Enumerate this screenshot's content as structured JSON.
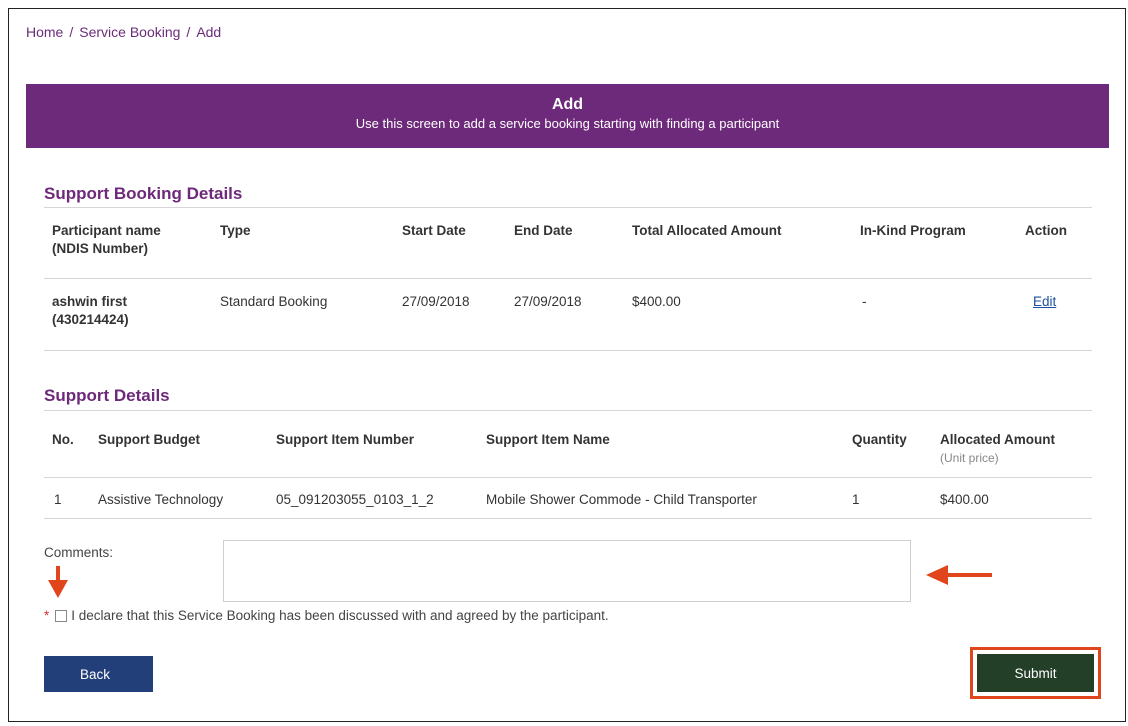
{
  "breadcrumb": {
    "home": "Home",
    "service_booking": "Service Booking",
    "current": "Add",
    "sep": "/"
  },
  "banner": {
    "title": "Add",
    "subtitle": "Use this screen to add a service booking starting with finding a participant"
  },
  "booking": {
    "title": "Support Booking Details",
    "headers": {
      "participant_line1": "Participant name",
      "participant_line2": "(NDIS Number)",
      "type": "Type",
      "start": "Start Date",
      "end": "End Date",
      "total": "Total Allocated Amount",
      "inkind": "In-Kind Program",
      "action": "Action"
    },
    "row": {
      "name": "ashwin first",
      "ndis": "(430214424)",
      "type": "Standard Booking",
      "start": "27/09/2018",
      "end": "27/09/2018",
      "total": "$400.00",
      "inkind": "-",
      "action": "Edit"
    }
  },
  "support": {
    "title": "Support Details",
    "headers": {
      "no": "No.",
      "budget": "Support Budget",
      "item_number": "Support Item Number",
      "item_name": "Support Item Name",
      "quantity": "Quantity",
      "allocated": "Allocated Amount",
      "unit_price": "(Unit price)"
    },
    "row": {
      "no": "1",
      "budget": "Assistive Technology",
      "item_number": "05_091203055_0103_1_2",
      "item_name": "Mobile Shower Commode - Child Transporter",
      "quantity": "1",
      "allocated": "$400.00"
    }
  },
  "comments": {
    "label": "Comments:",
    "value": ""
  },
  "declaration": {
    "required": "*",
    "text": "I declare that this Service Booking has been discussed with and agreed by the participant.",
    "checked": false
  },
  "buttons": {
    "back": "Back",
    "submit": "Submit"
  },
  "colors": {
    "banner": "#6d2a7a",
    "back_button": "#233f7a",
    "submit_button": "#233f28",
    "annotation": "#e0451c"
  }
}
